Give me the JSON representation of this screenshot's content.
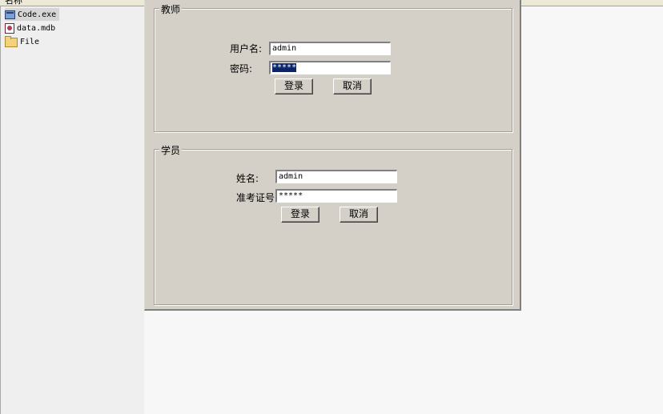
{
  "explorer": {
    "column_header": "名称",
    "files": [
      {
        "name": "Code.exe",
        "icon": "exe-file-icon"
      },
      {
        "name": "data.mdb",
        "icon": "database-file-icon"
      },
      {
        "name": "File",
        "icon": "folder-icon"
      }
    ]
  },
  "teacher": {
    "group_title": "教师",
    "username_label": "用户名:",
    "username_value": "admin",
    "password_label": "密码:",
    "password_value": "*****",
    "login_label": "登录",
    "cancel_label": "取消"
  },
  "student": {
    "group_title": "学员",
    "name_label": "姓名:",
    "name_value": "admin",
    "ticket_label": "准考证号",
    "ticket_value": "*****",
    "login_label": "登录",
    "cancel_label": "取消"
  }
}
